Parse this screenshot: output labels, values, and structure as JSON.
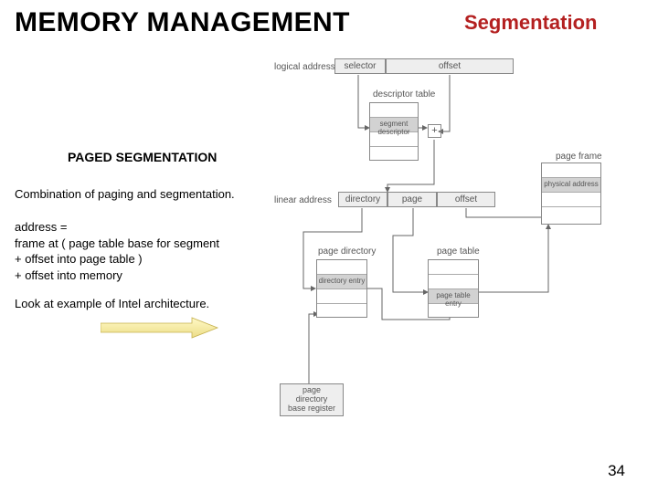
{
  "header": {
    "title": "MEMORY MANAGEMENT",
    "subtitle": "Segmentation"
  },
  "section": {
    "heading": "PAGED SEGMENTATION",
    "desc": "Combination of paging and segmentation.",
    "addr_lines": [
      "address   =",
      "    frame at ( page table base for segment",
      "        +        offset into page table )",
      "        +        offset into memory"
    ],
    "example": "Look at example of Intel architecture."
  },
  "diagram": {
    "labels": {
      "logical_address": "logical address",
      "selector": "selector",
      "offset_top": "offset",
      "descriptor_table": "descriptor table",
      "segment_descriptor": "segment descriptor",
      "plus": "+",
      "linear_address": "linear address",
      "directory": "directory",
      "page": "page",
      "offset_mid": "offset",
      "page_frame": "page frame",
      "physical_address": "physical address",
      "page_directory": "page directory",
      "page_table": "page table",
      "directory_entry": "directory entry",
      "page_table_entry": "page table entry",
      "page_directory_base_register": "page directory\nbase register"
    }
  },
  "page_number": "34"
}
